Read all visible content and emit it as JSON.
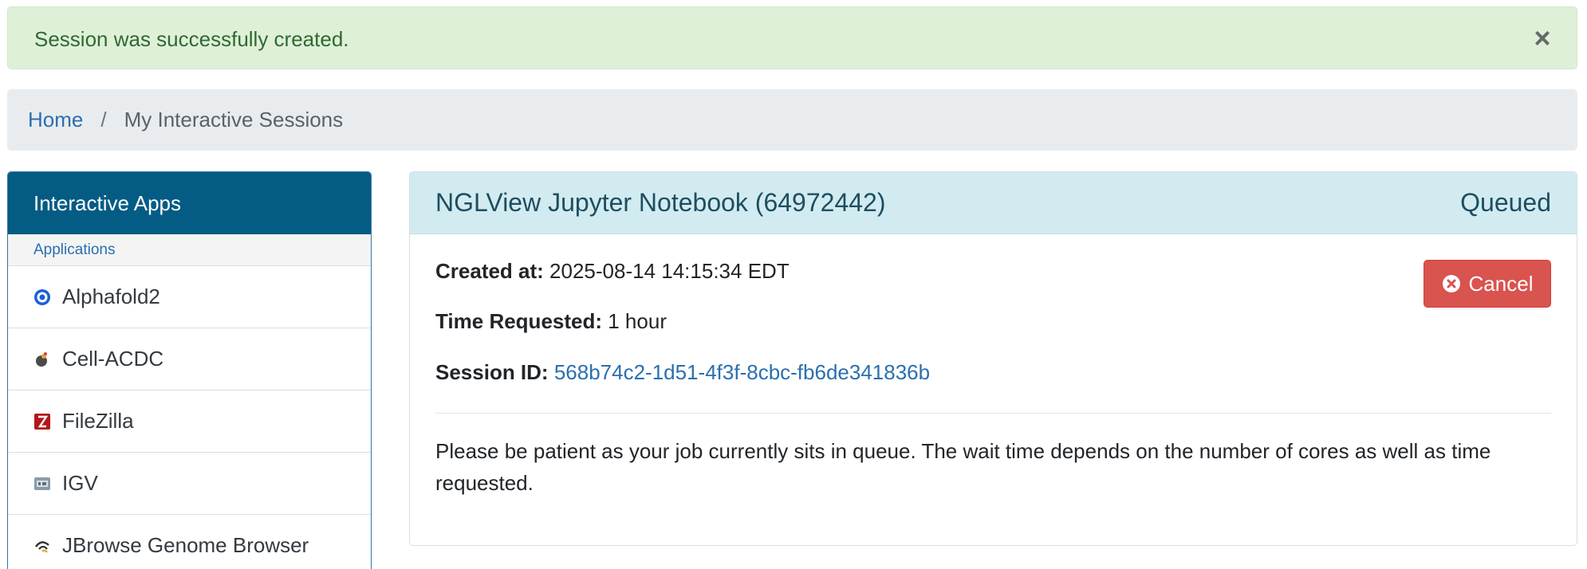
{
  "alert": {
    "message": "Session was successfully created.",
    "close_label": "×"
  },
  "breadcrumb": {
    "home": "Home",
    "separator": "/",
    "current": "My Interactive Sessions"
  },
  "sidebar": {
    "title": "Interactive Apps",
    "section": "Applications",
    "items": [
      {
        "label": "Alphafold2",
        "icon": "alphafold-icon"
      },
      {
        "label": "Cell-ACDC",
        "icon": "cell-acdc-icon"
      },
      {
        "label": "FileZilla",
        "icon": "filezilla-icon"
      },
      {
        "label": "IGV",
        "icon": "igv-icon"
      },
      {
        "label": "JBrowse Genome Browser",
        "icon": "jbrowse-icon"
      }
    ]
  },
  "session": {
    "title": "NGLView Jupyter Notebook (64972442)",
    "status": "Queued",
    "created_label": "Created at:",
    "created_value": "2025-08-14 14:15:34 EDT",
    "time_label": "Time Requested:",
    "time_value": "1 hour",
    "id_label": "Session ID:",
    "id_value": "568b74c2-1d51-4f3f-8cbc-fb6de341836b",
    "cancel_label": "Cancel",
    "message": "Please be patient as your job currently sits in queue. The wait time depends on the number of cores as well as time requested."
  },
  "colors": {
    "alert_bg": "#dff0d8",
    "alert_text": "#2f6a31",
    "sidebar_header": "#045c84",
    "card_header": "#d2ebf1",
    "link": "#2a6fb0",
    "danger": "#d9534f"
  }
}
